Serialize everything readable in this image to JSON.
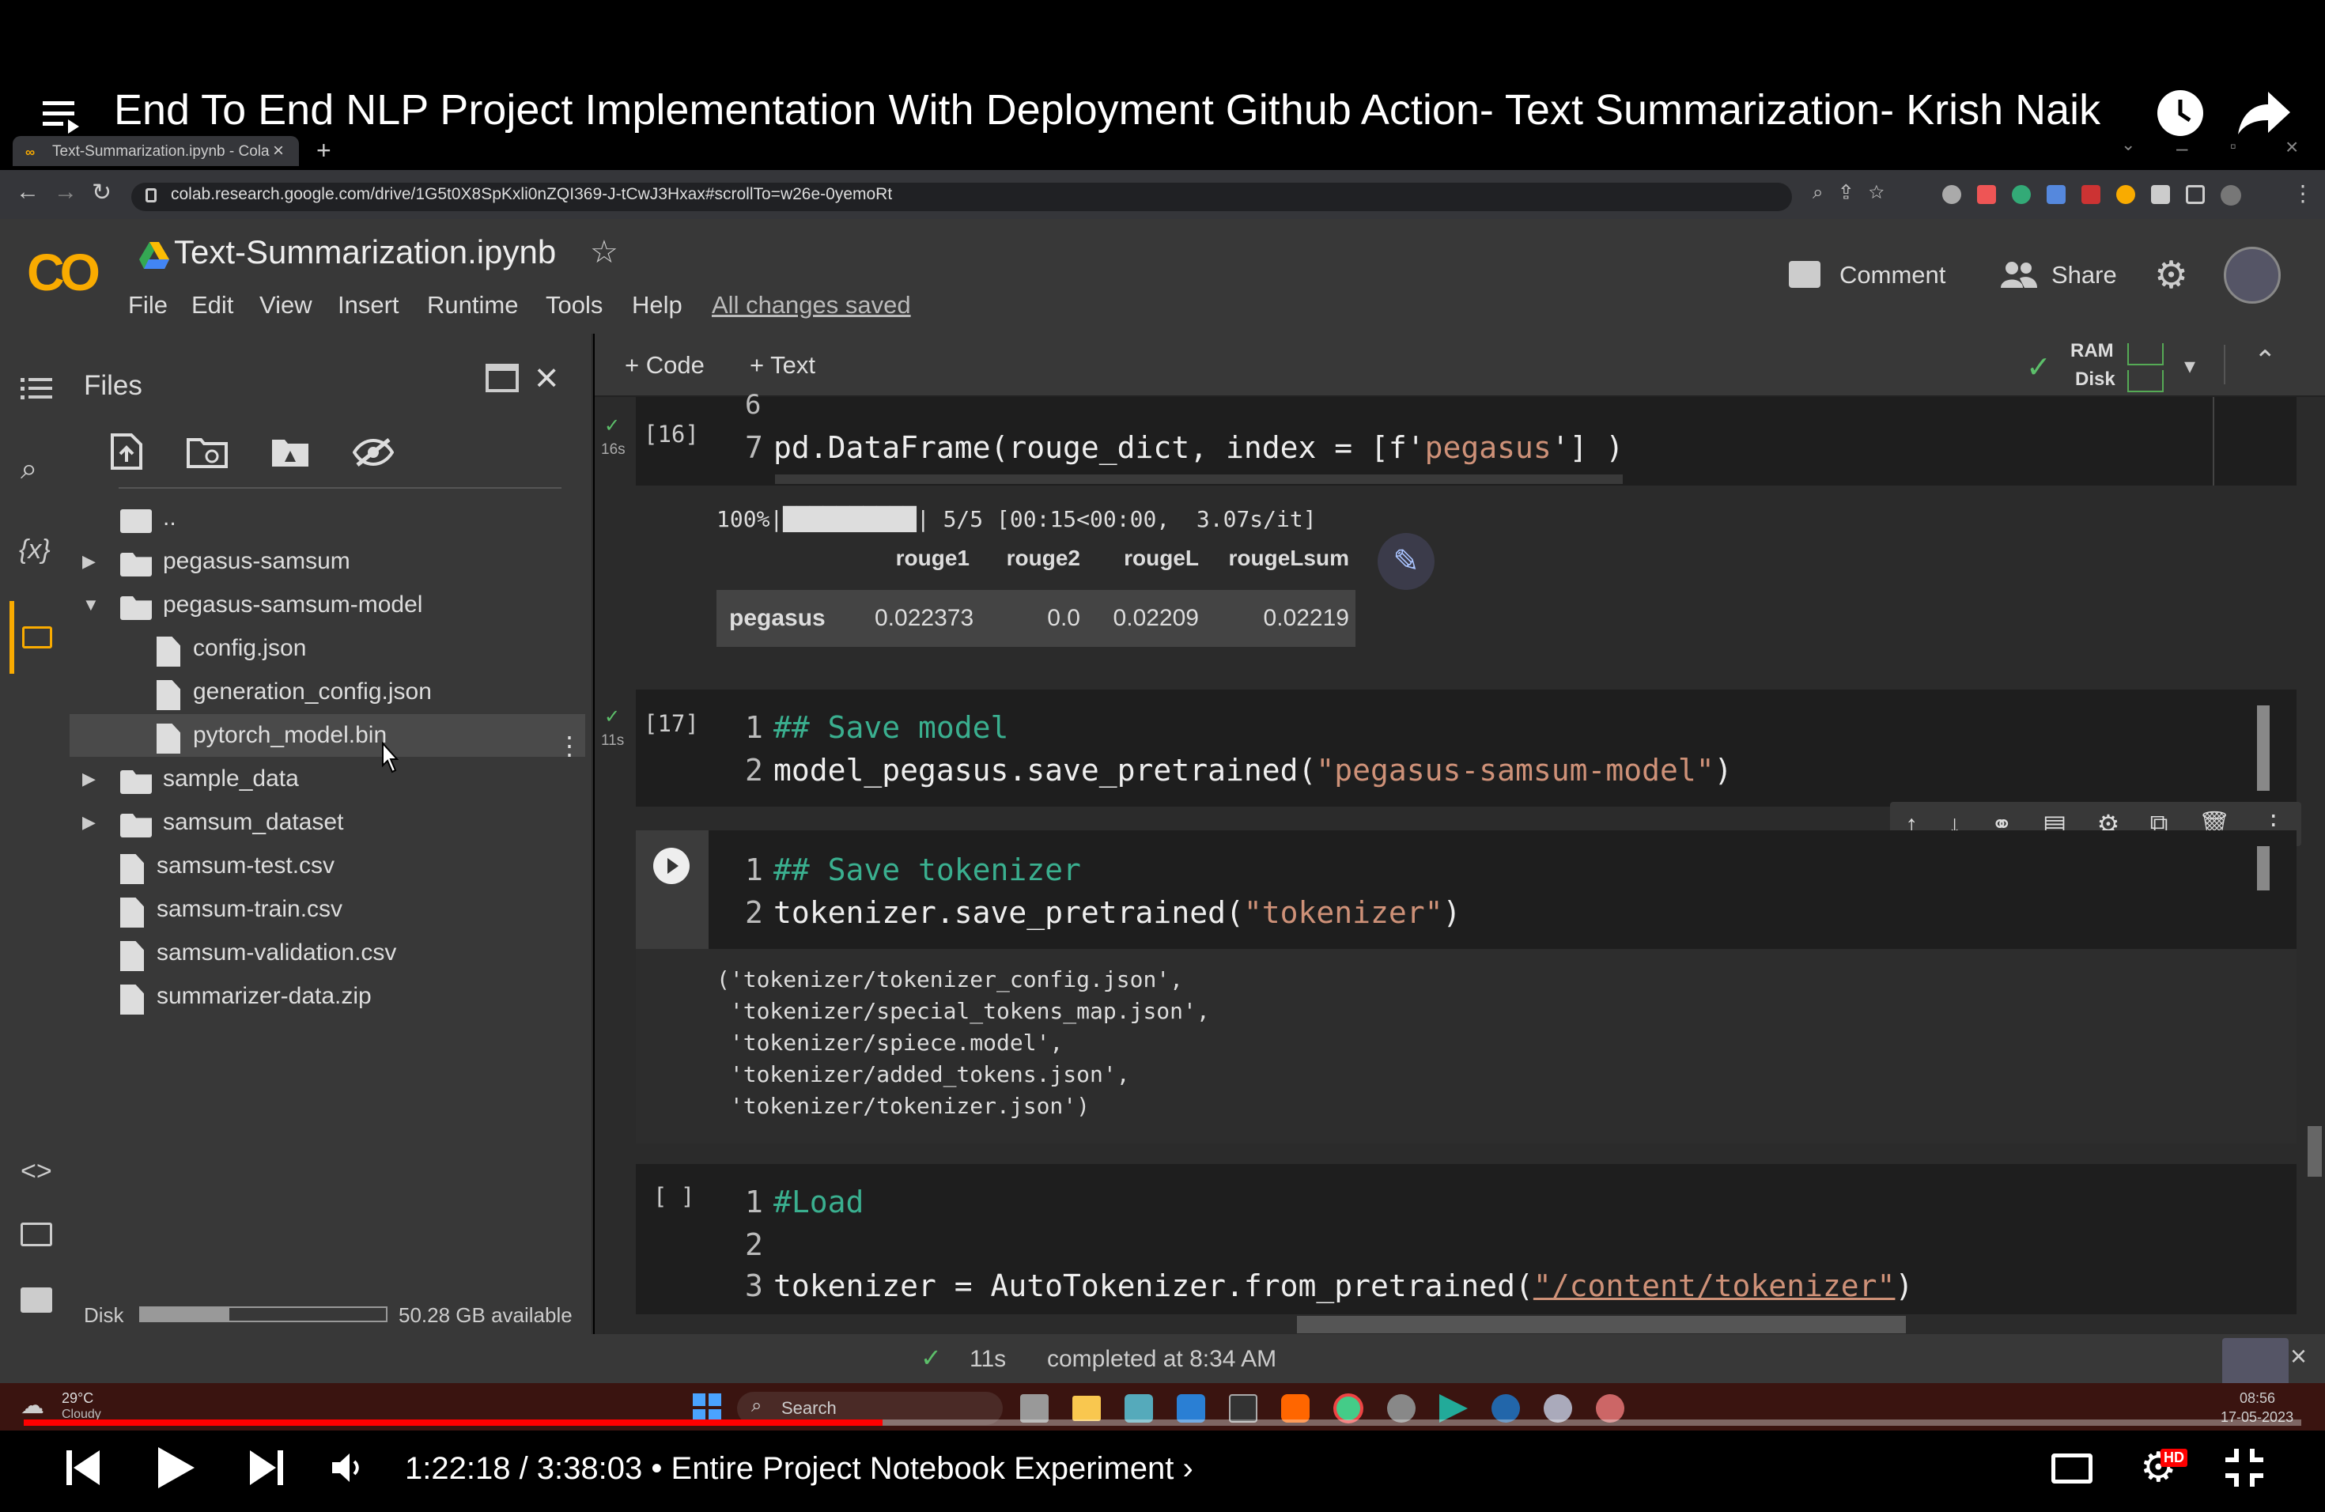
{
  "video": {
    "title": "End To End NLP Project Implementation With Deployment Github Action- Text Summarization- Krish Naik",
    "time": "1:22:18 / 3:38:03",
    "chapter": "• Entire Project Notebook Experiment",
    "chapter_arrow": "›",
    "progress": 0.377,
    "hd_badge": "HD"
  },
  "browser": {
    "tab_title": "Text-Summarization.ipynb - Cola",
    "url": "colab.research.google.com/drive/1G5t0X8SpKxli0nZQI369-J-tCwJ3Hxax#scrollTo=w26e-0yemoRt"
  },
  "colab": {
    "logo": "CO",
    "notebook_title": "Text-Summarization.ipynb",
    "menu": [
      "File",
      "Edit",
      "View",
      "Insert",
      "Runtime",
      "Tools",
      "Help"
    ],
    "saved_status": "All changes saved",
    "comment": "Comment",
    "share": "Share",
    "add_code": "+ Code",
    "add_text": "+ Text",
    "ram": "RAM",
    "disk": "Disk"
  },
  "files": {
    "title": "Files",
    "tree": [
      {
        "name": "..",
        "type": "up",
        "indent": 0
      },
      {
        "name": "pegasus-samsum",
        "type": "folder",
        "indent": 0,
        "expanded": false
      },
      {
        "name": "pegasus-samsum-model",
        "type": "folder",
        "indent": 0,
        "expanded": true
      },
      {
        "name": "config.json",
        "type": "file",
        "indent": 1
      },
      {
        "name": "generation_config.json",
        "type": "file",
        "indent": 1
      },
      {
        "name": "pytorch_model.bin",
        "type": "file",
        "indent": 1,
        "selected": true
      },
      {
        "name": "sample_data",
        "type": "folder",
        "indent": 0,
        "expanded": false
      },
      {
        "name": "samsum_dataset",
        "type": "folder",
        "indent": 0,
        "expanded": false
      },
      {
        "name": "samsum-test.csv",
        "type": "file",
        "indent": 0
      },
      {
        "name": "samsum-train.csv",
        "type": "file",
        "indent": 0
      },
      {
        "name": "samsum-validation.csv",
        "type": "file",
        "indent": 0
      },
      {
        "name": "summarizer-data.zip",
        "type": "file",
        "indent": 0
      }
    ],
    "disk_label": "Disk",
    "disk_available": "50.28 GB available",
    "disk_used": 0.36
  },
  "cells": {
    "c16": {
      "exec": "[16]",
      "time": "16s",
      "line6": "6",
      "line7_num": "7",
      "line7_a": "pd.DataFrame(rouge_dict, index = [f'",
      "line7_b": "pegasus",
      "line7_c": "'] )",
      "progress": "100%|██████████| 5/5 [00:15<00:00,  3.07s/it]",
      "table_headers": [
        "rouge1",
        "rouge2",
        "rougeL",
        "rougeLsum"
      ],
      "table_row_label": "pegasus",
      "table_row": [
        "0.022373",
        "0.0",
        "0.02209",
        "0.02219"
      ]
    },
    "c17": {
      "exec": "[17]",
      "time": "11s",
      "l1": "## Save model",
      "l2a": "model_pegasus.save_pretrained(",
      "l2b": "\"pegasus-samsum-model\"",
      "l2c": ")"
    },
    "c18": {
      "l1": "## Save tokenizer",
      "l2a": "tokenizer.save_pretrained(",
      "l2b": "\"tokenizer\"",
      "l2c": ")",
      "output": [
        "('tokenizer/tokenizer_config.json',",
        " 'tokenizer/special_tokens_map.json',",
        " 'tokenizer/spiece.model',",
        " 'tokenizer/added_tokens.json',",
        " 'tokenizer/tokenizer.json')"
      ]
    },
    "c19": {
      "exec": "[ ]",
      "l1": "#Load",
      "l2": "",
      "l3a": "tokenizer = AutoTokenizer.from_pretrained(",
      "l3b": "\"/content/tokenizer\"",
      "l3c": ")"
    }
  },
  "status": {
    "time": "11s",
    "text": "completed at 8:34 AM"
  },
  "taskbar": {
    "weather_temp": "29°C",
    "weather_cond": "Cloudy",
    "search": "Search",
    "clock_time": "08:56",
    "clock_date": "17-05-2023"
  },
  "colors": {
    "accent_orange": "#f9ab00",
    "youtube_red": "#ff0000",
    "keyword_green": "#3aaf8f",
    "string": "#ce9178"
  }
}
